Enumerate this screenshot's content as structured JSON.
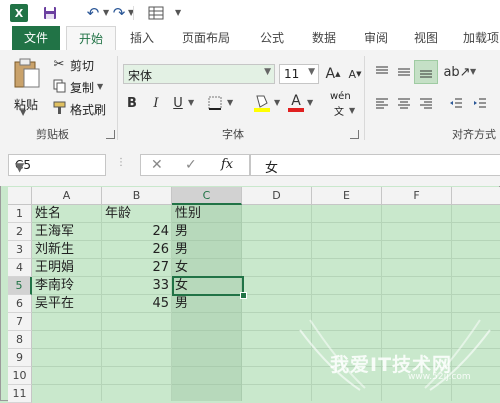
{
  "quick_access": {
    "excel_logo": "X",
    "icons": [
      "excel-logo-icon",
      "save-icon",
      "undo-icon",
      "redo-icon",
      "form-icon",
      "customize-icon"
    ]
  },
  "tabs": [
    {
      "label": "文件"
    },
    {
      "label": "开始"
    },
    {
      "label": "插入"
    },
    {
      "label": "页面布局"
    },
    {
      "label": "公式"
    },
    {
      "label": "数据"
    },
    {
      "label": "审阅"
    },
    {
      "label": "视图"
    },
    {
      "label": "加载项"
    }
  ],
  "ribbon": {
    "clipboard": {
      "paste": "粘贴",
      "cut": "剪切",
      "copy": "复制",
      "format_painter": "格式刷",
      "group_label": "剪贴板"
    },
    "font": {
      "font_name": "宋体",
      "font_size": "11",
      "bold": "B",
      "italic": "I",
      "underline": "U",
      "grow": "A",
      "shrink": "A",
      "fill_color_letter": "A",
      "wen": "wén",
      "wen_sub": "文",
      "group_label": "字体"
    },
    "alignment": {
      "group_label": "对齐方式"
    }
  },
  "formula_bar": {
    "name_box": "C5",
    "cancel": "✕",
    "enter": "✓",
    "fx": "fx",
    "content": "女"
  },
  "columns": [
    "A",
    "B",
    "C",
    "D",
    "E",
    "F"
  ],
  "selected_column": "C",
  "rows": [
    "1",
    "2",
    "3",
    "4",
    "5",
    "6",
    "7",
    "8",
    "9",
    "10",
    "11"
  ],
  "selected_row": "5",
  "table": {
    "headers": [
      "姓名",
      "年龄",
      "性别"
    ],
    "records": [
      {
        "name": "王海军",
        "age": "24",
        "gender": "男"
      },
      {
        "name": "刘新生",
        "age": "26",
        "gender": "男"
      },
      {
        "name": "王明娟",
        "age": "27",
        "gender": "女"
      },
      {
        "name": "李南玲",
        "age": "33",
        "gender": "女"
      },
      {
        "name": "吴平在",
        "age": "45",
        "gender": "男"
      }
    ]
  },
  "colors": {
    "accent": "#217346",
    "sheet_fill": "#c9e8cc"
  },
  "watermark": {
    "text": "我爱IT技术网",
    "url": "www.52ij.com"
  }
}
